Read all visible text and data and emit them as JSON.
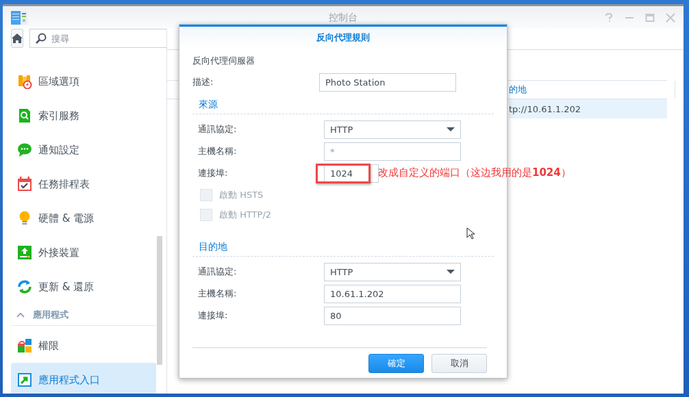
{
  "window": {
    "title": "控制台"
  },
  "sidebar": {
    "search": {
      "placeholder": "搜尋"
    },
    "items": [
      {
        "kind": "item",
        "label": "區域選項",
        "selected": false
      },
      {
        "kind": "item",
        "label": "索引服務",
        "selected": false
      },
      {
        "kind": "item",
        "label": "通知設定",
        "selected": false
      },
      {
        "kind": "item",
        "label": "任務排程表",
        "selected": false
      },
      {
        "kind": "item",
        "label": "硬體 & 電源",
        "selected": false
      },
      {
        "kind": "item",
        "label": "外接裝置",
        "selected": false
      },
      {
        "kind": "item",
        "label": "更新 & 還原",
        "selected": false
      },
      {
        "kind": "section",
        "label": "應用程式",
        "expanded": true
      },
      {
        "kind": "item",
        "label": "權限",
        "selected": false
      },
      {
        "kind": "item",
        "label": "應用程式入口",
        "selected": true
      }
    ]
  },
  "table": {
    "columns": [
      "的地"
    ],
    "rows": [
      {
        "cells": [
          "tp://10.61.1.202"
        ],
        "selected": true
      }
    ]
  },
  "dialog": {
    "title": "反向代理規則",
    "subtitle": "反向代理伺服器",
    "description": {
      "label": "描述:",
      "value": "Photo Station"
    },
    "sections": [
      {
        "title": "來源",
        "fields": [
          {
            "kind": "select",
            "label": "通訊協定:",
            "value": "HTTP"
          },
          {
            "kind": "text",
            "label": "主機名稱:",
            "placeholder": "*"
          },
          {
            "kind": "text",
            "label": "連接埠:",
            "value": "1024",
            "highlighted": true,
            "note": "改成自定义的端口（这边我用的是**1024**）"
          },
          {
            "kind": "checkbox",
            "label": "啟動 HSTS",
            "checked": false,
            "disabled": true
          },
          {
            "kind": "checkbox",
            "label": "啟動 HTTP/2",
            "checked": false,
            "disabled": true
          }
        ]
      },
      {
        "title": "目的地",
        "fields": [
          {
            "kind": "select",
            "label": "通訊協定:",
            "value": "HTTP"
          },
          {
            "kind": "text",
            "label": "主機名稱:",
            "value": "10.61.1.202"
          },
          {
            "kind": "text",
            "label": "連接埠:",
            "value": "80"
          }
        ]
      }
    ],
    "buttons": [
      {
        "kind": "primary",
        "label": "確定"
      },
      {
        "kind": "secondary",
        "label": "取消"
      }
    ]
  }
}
